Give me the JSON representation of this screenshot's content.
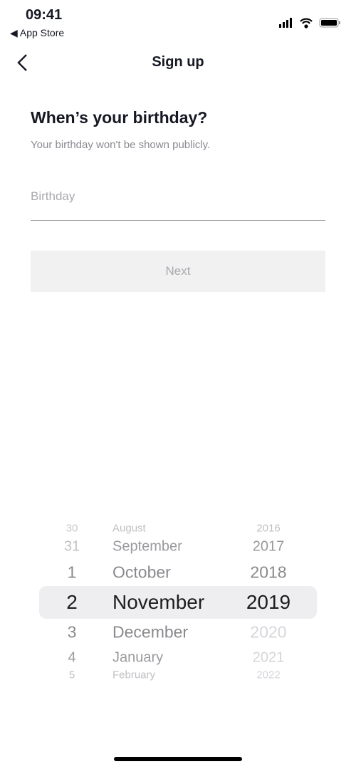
{
  "status_bar": {
    "time": "09:41",
    "back_app": "◀ App Store"
  },
  "header": {
    "title": "Sign up"
  },
  "main": {
    "heading": "When’s your birthday?",
    "subtitle": "Your birthday won't be shown publicly.",
    "birthday_placeholder": "Birthday",
    "next_label": "Next"
  },
  "picker": {
    "rows": [
      {
        "day": "30",
        "month": "August",
        "year": "2016",
        "year_disabled": false
      },
      {
        "day": "31",
        "month": "September",
        "year": "2017",
        "year_disabled": false
      },
      {
        "day": "1",
        "month": "October",
        "year": "2018",
        "year_disabled": false
      },
      {
        "day": "2",
        "month": "November",
        "year": "2019",
        "year_disabled": false,
        "selected": true
      },
      {
        "day": "3",
        "month": "December",
        "year": "2020",
        "year_disabled": true
      },
      {
        "day": "4",
        "month": "January",
        "year": "2021",
        "year_disabled": true
      },
      {
        "day": "5",
        "month": "February",
        "year": "2022",
        "year_disabled": true
      }
    ]
  }
}
